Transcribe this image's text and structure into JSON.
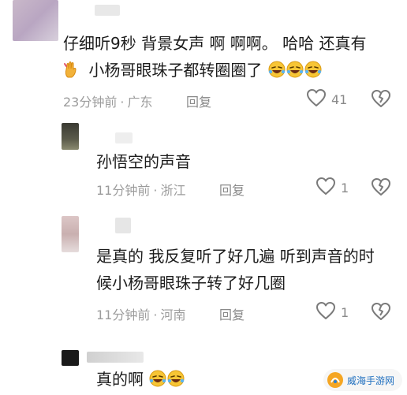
{
  "comments": [
    {
      "lines": [
        "仔细听9秒 背景女声 啊 啊啊。  哈哈  还真有",
        "小杨哥眼珠子都转圈圈了"
      ],
      "time": "23分钟前",
      "location": "广东",
      "reply_label": "回复",
      "likes": "41"
    },
    {
      "lines": [
        "孙悟空的声音"
      ],
      "time": "11分钟前",
      "location": "浙江",
      "reply_label": "回复",
      "likes": "1"
    },
    {
      "lines": [
        "是真的 我反复听了好几遍 听到声音的时",
        "候小杨哥眼珠子转了好几圈"
      ],
      "time": "11分钟前",
      "location": "河南",
      "reply_label": "回复",
      "likes": "1"
    },
    {
      "lines": [
        "真的啊"
      ],
      "time": "",
      "location": "",
      "reply_label": "",
      "likes": ""
    }
  ],
  "meta_separator": "·",
  "colors": {
    "accent_orange": "#f0a020",
    "text": "#1c1c1c",
    "meta": "#9c9c9c"
  },
  "icons": [
    "hand-icon",
    "rofl-emoji-icon",
    "heart-outline-icon",
    "broken-heart-icon",
    "logo-icon"
  ],
  "watermark": {
    "text": "威海手游网"
  }
}
